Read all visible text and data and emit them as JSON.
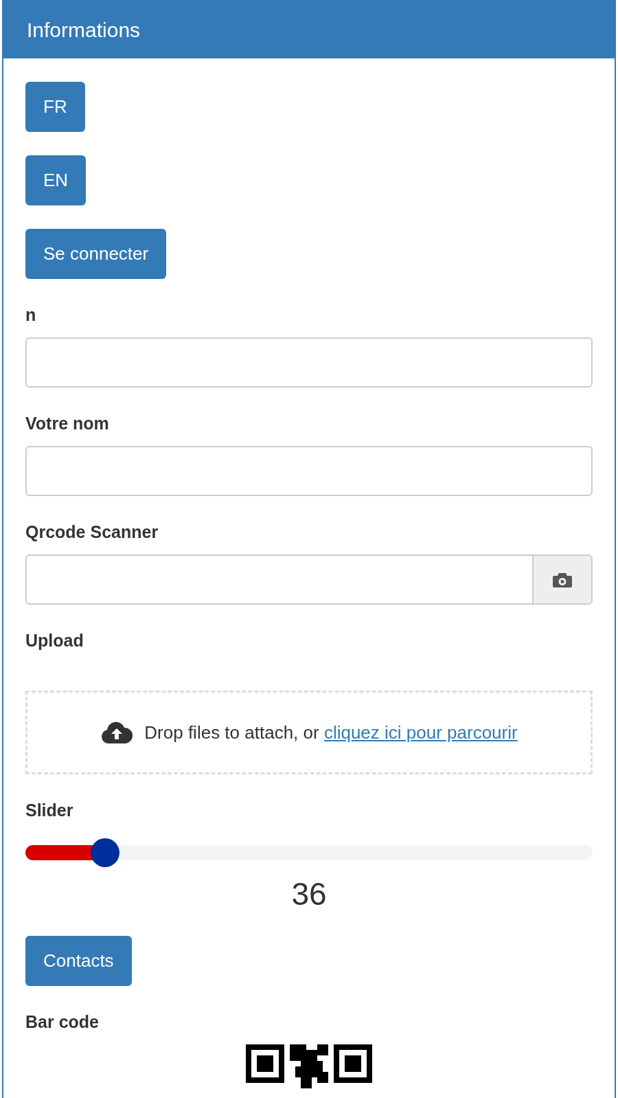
{
  "panel": {
    "title": "Informations"
  },
  "buttons": [
    {
      "label": "FR"
    },
    {
      "label": "EN"
    },
    {
      "label": "Se connecter"
    }
  ],
  "fields": [
    {
      "label": "n",
      "kind": "text"
    },
    {
      "label": "Votre nom",
      "kind": "text"
    },
    {
      "label": "Qrcode Scanner",
      "kind": "scanner"
    }
  ],
  "upload": {
    "label": "Upload",
    "text": "Drop files to attach, or ",
    "link": "cliquez ici pour parcourir"
  },
  "slider": {
    "label": "Slider",
    "level": 0.14,
    "reading": "36"
  },
  "contacts_button": {
    "label": "Contacts"
  },
  "barcode": {
    "label": "Bar code"
  }
}
